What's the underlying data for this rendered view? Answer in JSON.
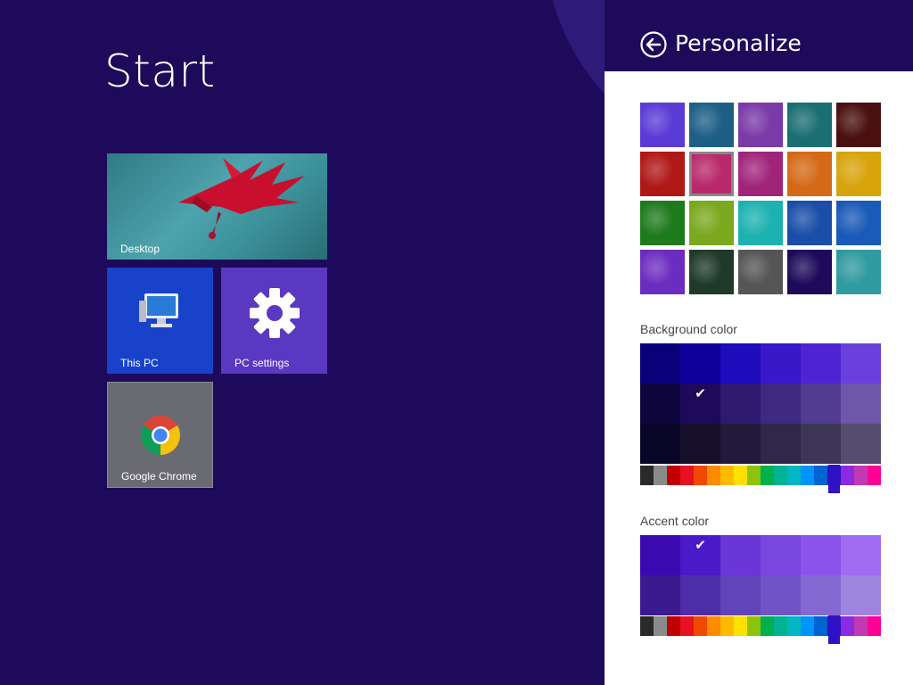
{
  "start": {
    "title": "Start",
    "tiles": [
      {
        "label": "Desktop"
      },
      {
        "label": "This PC"
      },
      {
        "label": "PC settings"
      },
      {
        "label": "Google Chrome"
      }
    ]
  },
  "panel": {
    "title": "Personalize",
    "background_color_label": "Background color",
    "accent_color_label": "Accent color",
    "background_patterns": [
      [
        "#5a3bd6",
        "#1e5f86",
        "#7a3aa8",
        "#1b6e72",
        "#4a1010"
      ],
      [
        "#b01818",
        "#b8286a",
        "#a0257a",
        "#d46a18",
        "#d8a40c"
      ],
      [
        "#1f7a1c",
        "#7aa81e",
        "#1db2b0",
        "#1a4ea8",
        "#1a5ab8"
      ],
      [
        "#6b2cc0",
        "#1f3a2a",
        "#555555",
        "#1d0a5a",
        "#2f9aa0"
      ]
    ],
    "background_color_rows": [
      [
        "#09007a",
        "#0e009a",
        "#1e0cbc",
        "#3818c8",
        "#4e24d2",
        "#6a40dc"
      ],
      [
        "#10063e",
        "#1d0a5a",
        "#2e1a6e",
        "#3e2a82",
        "#523c92",
        "#6e56a8"
      ],
      [
        "#0a0628",
        "#16102c",
        "#221a3a",
        "#302848",
        "#3e3656",
        "#564c70"
      ]
    ],
    "accent_color_rows": [
      [
        "#3a0ab0",
        "#4a1ac8",
        "#6a36d8",
        "#7a46e0",
        "#8a54ea",
        "#a06cf2"
      ],
      [
        "#3a1a8e",
        "#4e2ea8",
        "#6244ba",
        "#7254c6",
        "#8668d2",
        "#9e84de"
      ]
    ],
    "slider_colors": [
      "#2a2a2a",
      "#8a8a8a",
      "#c00000",
      "#e81123",
      "#f04a00",
      "#ff8c00",
      "#ffb900",
      "#fce100",
      "#8dc40a",
      "#00b050",
      "#00b294",
      "#00b7c3",
      "#0094ff",
      "#0063d1",
      "#2f12c4",
      "#8a2be2",
      "#c239b3",
      "#ff0097"
    ],
    "background_selected": {
      "row": 1,
      "col": 1
    },
    "accent_selected": {
      "row": 0,
      "col": 1
    },
    "slider_selected_index": 14
  }
}
